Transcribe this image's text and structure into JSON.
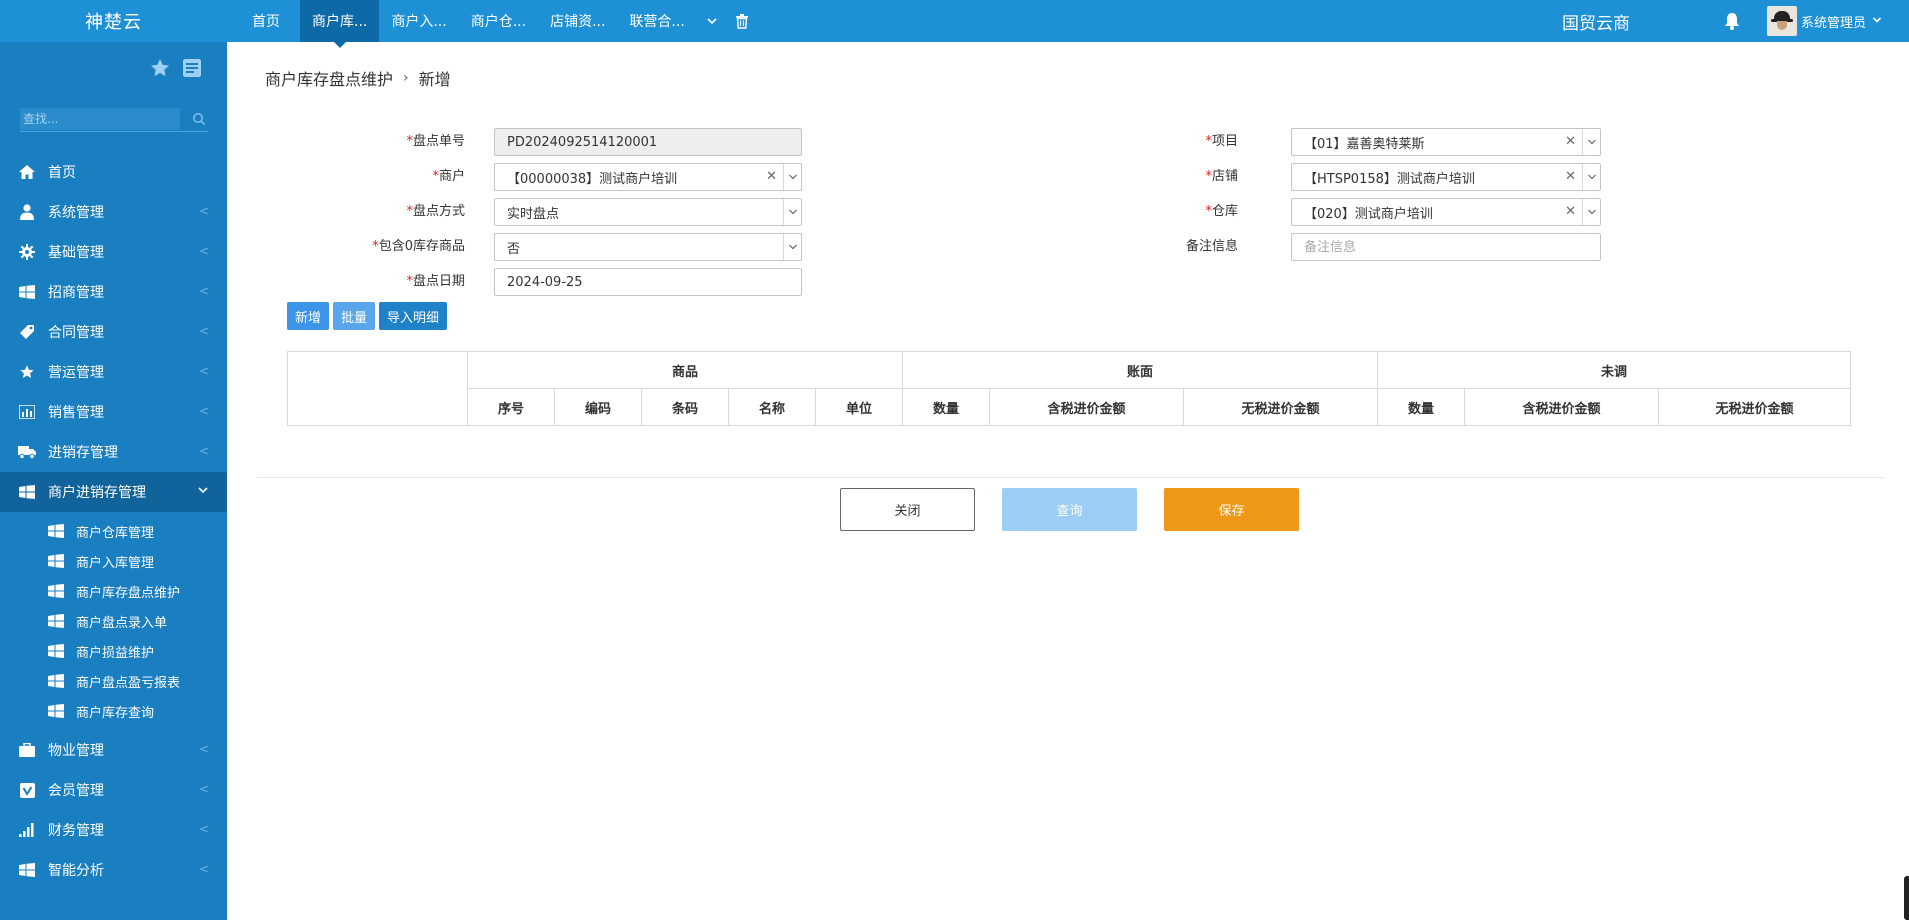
{
  "brand": "神楚云",
  "topnav": {
    "tabs": [
      "首页",
      "商户库...",
      "商户入...",
      "商户仓...",
      "店铺资...",
      "联营合..."
    ],
    "active_index": 1,
    "more_icon": "chevron-down-icon",
    "clear_icon": "trash-icon"
  },
  "header": {
    "org_name": "国贸云商",
    "user_name": "系统管理员"
  },
  "sidebar": {
    "search_placeholder": "查找...",
    "menu": [
      {
        "label": "首页",
        "icon": "home-icon"
      },
      {
        "label": "系统管理",
        "icon": "user-icon"
      },
      {
        "label": "基础管理",
        "icon": "gear-icon"
      },
      {
        "label": "招商管理",
        "icon": "windows-icon"
      },
      {
        "label": "合同管理",
        "icon": "tag-icon"
      },
      {
        "label": "营运管理",
        "icon": "star-icon"
      },
      {
        "label": "销售管理",
        "icon": "bar-chart-icon"
      },
      {
        "label": "进销存管理",
        "icon": "truck-icon"
      },
      {
        "label": "商户进销存管理",
        "icon": "windows-icon"
      }
    ],
    "submenu": [
      "商户仓库管理",
      "商户入库管理",
      "商户库存盘点维护",
      "商户盘点录入单",
      "商户损益维护",
      "商户盘点盈亏报表",
      "商户库存查询"
    ],
    "menu_after": [
      {
        "label": "物业管理",
        "icon": "briefcase-icon"
      },
      {
        "label": "会员管理",
        "icon": "vimeo-icon"
      },
      {
        "label": "财务管理",
        "icon": "signal-icon"
      },
      {
        "label": "智能分析",
        "icon": "windows-icon"
      }
    ]
  },
  "breadcrumb": {
    "parent": "商户库存盘点维护",
    "separator": "›",
    "current": "新增"
  },
  "form": {
    "required_mark": "*",
    "doc_no": {
      "label": "盘点单号",
      "value": "PD2024092514120001"
    },
    "merchant": {
      "label": "商户",
      "value": "【00000038】测试商户培训"
    },
    "method": {
      "label": "盘点方式",
      "value": "实时盘点"
    },
    "include_zero": {
      "label": "包含0库存商品",
      "value": "否"
    },
    "date": {
      "label": "盘点日期",
      "value": "2024-09-25"
    },
    "project": {
      "label": "项目",
      "value": "【01】嘉善奥特莱斯"
    },
    "shop": {
      "label": "店铺",
      "value": "【HTSP0158】测试商户培训"
    },
    "warehouse": {
      "label": "仓库",
      "value": "【020】测试商户培训"
    },
    "remark": {
      "label": "备注信息",
      "placeholder": "备注信息",
      "value": ""
    }
  },
  "actions": {
    "add": "新增",
    "batch": "批量",
    "import": "导入明细"
  },
  "table": {
    "groups": [
      "商品",
      "账面",
      "未调"
    ],
    "goods_cols": [
      "序号",
      "编码",
      "条码",
      "名称",
      "单位"
    ],
    "book_cols": [
      "数量",
      "含税进价金额",
      "无税进价金额"
    ],
    "adjust_cols": [
      "数量",
      "含税进价金额",
      "无税进价金额"
    ]
  },
  "footer_buttons": {
    "close": "关闭",
    "query": "查询",
    "save": "保存"
  },
  "colors": {
    "topbar": "#1e90d6",
    "sidebar": "#1a7fc1",
    "save": "#ef9716",
    "query": "#9ccdf5",
    "primary": "#3c95e6"
  }
}
